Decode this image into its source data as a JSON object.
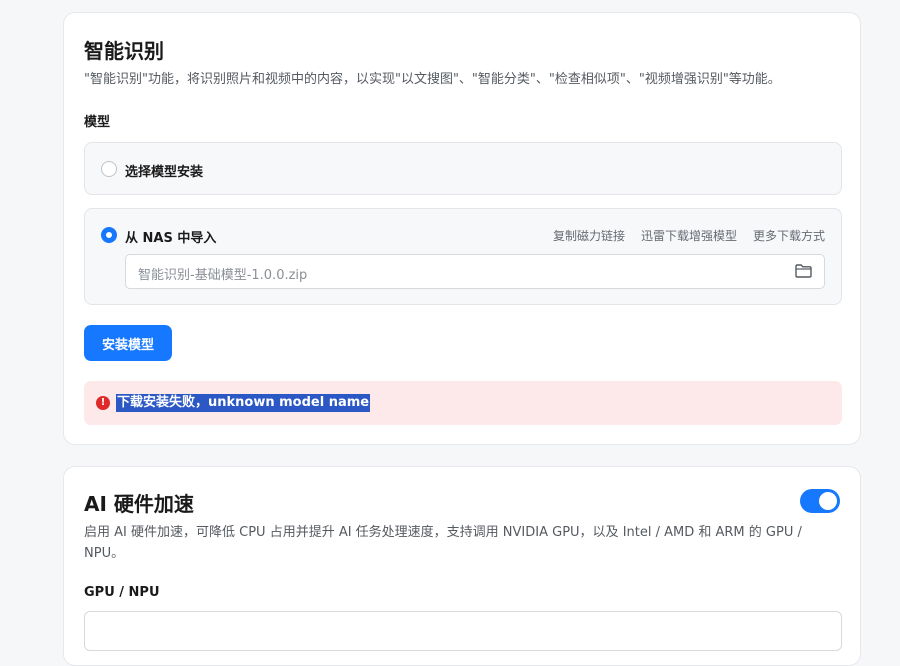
{
  "smart_recognition": {
    "title": "智能识别",
    "description": "\"智能识别\"功能，将识别照片和视频中的内容，以实现\"以文搜图\"、\"智能分类\"、\"检查相似项\"、\"视频增强识别\"等功能。",
    "model_label": "模型",
    "option_select_install": {
      "label": "选择模型安装",
      "selected": false
    },
    "option_import_nas": {
      "label": "从 NAS 中导入",
      "selected": true,
      "links": [
        "复制磁力链接",
        "迅雷下载增强模型",
        "更多下载方式"
      ],
      "file_value": "智能识别-基础模型-1.0.0.zip"
    },
    "install_button": "安装模型",
    "error_message": "下载安装失败，unknown model name"
  },
  "ai_acceleration": {
    "title": "AI 硬件加速",
    "enabled": true,
    "description_line1": "启用 AI 硬件加速，可降低 CPU 占用并提升 AI 任务处理速度，支持调用 NVIDIA GPU，以及 Intel / AMD 和 ARM 的 GPU /",
    "description_line2": "NPU。",
    "gpu_label": "GPU / NPU"
  },
  "colors": {
    "accent": "#1677ff",
    "error_bg": "#fde8ea",
    "error_icon": "#e02a2a",
    "selection_highlight": "#2b58c5"
  },
  "icons": {
    "folder": "folder-icon",
    "error": "error-circle-icon"
  }
}
